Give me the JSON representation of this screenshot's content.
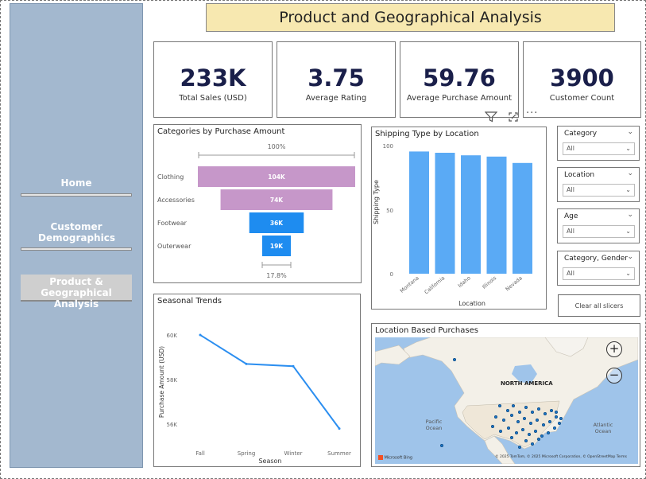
{
  "title": "Product and Geographical Analysis",
  "nav": {
    "home": "Home",
    "customer_demographics": "Customer Demographics",
    "product_geo": "Product & Geographical Analysis"
  },
  "kpis": [
    {
      "value": "233K",
      "label": "Total Sales (USD)"
    },
    {
      "value": "3.75",
      "label": "Average Rating"
    },
    {
      "value": "59.76",
      "label": "Average Purchase Amount"
    },
    {
      "value": "3900",
      "label": "Customer Count"
    }
  ],
  "funnel": {
    "title": "Categories by Purchase Amount",
    "top_pct": "100%",
    "bottom_pct": "17.8%",
    "rows": [
      {
        "label": "Clothing",
        "value_label": "104K"
      },
      {
        "label": "Accessories",
        "value_label": "74K"
      },
      {
        "label": "Footwear",
        "value_label": "36K"
      },
      {
        "label": "Outerwear",
        "value_label": "19K"
      }
    ]
  },
  "shipping": {
    "title": "Shipping Type by Location",
    "ylabel": "Shipping Type",
    "xlabel": "Location",
    "yticks": [
      "100",
      "50",
      "0"
    ]
  },
  "seasonal": {
    "title": "Seasonal Trends",
    "ylabel": "Purchase Amount (USD)",
    "xlabel": "Season",
    "yticks": [
      "60K",
      "58K",
      "56K"
    ]
  },
  "map": {
    "title": "Location Based Purchases",
    "region_label": "NORTH AMERICA",
    "ocean_pacific": "Pacific Ocean",
    "ocean_atlantic": "Atlantic Ocean",
    "logo": "Microsoft Bing",
    "credits": "© 2025 TomTom, © 2025 Microsoft Corporation, © OpenStreetMap  Terms"
  },
  "slicers": [
    {
      "label": "Category",
      "value": "All"
    },
    {
      "label": "Location",
      "value": "All"
    },
    {
      "label": "Age",
      "value": "All"
    },
    {
      "label": "Category, Gender",
      "value": "All"
    }
  ],
  "clear_label": "Clear all slicers",
  "colors": {
    "funnel_purple": "#c697c9",
    "funnel_blue": "#1e8cf0",
    "bar_blue": "#5aaaf5",
    "line_blue": "#2b8ef0",
    "sidebar": "#a3b8cf",
    "title_bg": "#f7e8b0"
  },
  "chart_data": [
    {
      "type": "bar",
      "title": "Categories by Purchase Amount",
      "categories": [
        "Clothing",
        "Accessories",
        "Footwear",
        "Outerwear"
      ],
      "values": [
        104,
        74,
        36,
        19
      ],
      "value_labels": [
        "104K",
        "74K",
        "36K",
        "19K"
      ]
    },
    {
      "type": "bar",
      "title": "Shipping Type by Location",
      "xlabel": "Location",
      "ylabel": "Shipping Type",
      "categories": [
        "Montana",
        "California",
        "Idaho",
        "Illinois",
        "Nevada"
      ],
      "values": [
        96,
        95,
        93,
        92,
        87
      ],
      "ylim": [
        0,
        100
      ]
    },
    {
      "type": "line",
      "title": "Seasonal Trends",
      "xlabel": "Season",
      "ylabel": "Purchase Amount (USD)",
      "categories": [
        "Fall",
        "Spring",
        "Winter",
        "Summer"
      ],
      "values": [
        60.0,
        58.7,
        58.6,
        55.8
      ],
      "ylim": [
        55.5,
        60.5
      ]
    }
  ]
}
